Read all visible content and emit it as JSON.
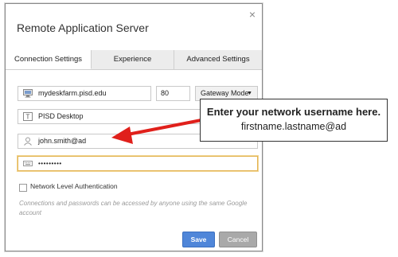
{
  "dialog": {
    "title": "Remote Application Server",
    "close_glyph": "×"
  },
  "tabs": [
    {
      "label": "Connection Settings",
      "active": true
    },
    {
      "label": "Experience",
      "active": false
    },
    {
      "label": "Advanced Settings",
      "active": false
    }
  ],
  "form": {
    "server": {
      "value": "mydeskfarm.pisd.edu",
      "icon": "monitor-icon"
    },
    "port": {
      "value": "80"
    },
    "gateway": {
      "value": "Gateway Mode",
      "caret": "▼"
    },
    "desktop": {
      "value": "PISD Desktop",
      "icon": "letter-t-icon"
    },
    "username": {
      "value": "john.smith@ad",
      "icon": "user-icon"
    },
    "password": {
      "value": "•••••••••",
      "icon": "keyboard-icon"
    },
    "nla": {
      "label": "Network Level Authentication",
      "checked": false
    },
    "note": "Connections and passwords can be accessed by anyone using the same Google account"
  },
  "buttons": {
    "save": "Save",
    "cancel": "Cancel"
  },
  "callout": {
    "line1": "Enter your network username here.",
    "line2": "firstname.lastname@ad",
    "arrow_color": "#e0201b"
  }
}
